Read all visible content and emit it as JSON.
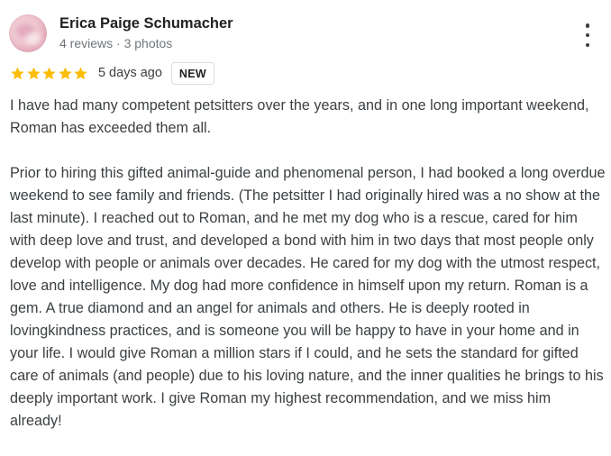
{
  "review": {
    "author_name": "Erica Paige Schumacher",
    "author_meta": "4 reviews · 3 photos",
    "rating": 5,
    "rating_max": 5,
    "date": "5 days ago",
    "badge": "NEW",
    "paragraphs": [
      "I have had many competent petsitters over the years, and in one long important weekend, Roman has exceeded them all.",
      "Prior to hiring this gifted animal-guide and phenomenal person, I had booked a long overdue weekend to see family and friends. (The petsitter I had originally hired was a no show at the last minute). I reached out to Roman, and he met my dog who is a rescue, cared for him with deep love and trust, and developed a bond with him in two days that most people only develop with people or animals over decades. He cared for my dog with the utmost respect, love and intelligence. My dog had more confidence in himself upon my return. Roman is a gem. A true diamond and an angel for animals and others. He is deeply rooted in lovingkindness practices, and is someone you will be happy to have in your home and in your life. I would give Roman a million stars if I could, and he sets the standard for gifted care of animals (and people) due to his loving nature, and the inner qualities he brings to his deeply important work. I give Roman my highest recommendation, and we miss him already!"
    ]
  },
  "icons": {
    "more": "more-vert-icon",
    "star": "star-icon"
  },
  "colors": {
    "star": "#fbbc04",
    "name": "#202124",
    "meta": "#70757a",
    "body": "#3c4043",
    "badge_border": "#dadce0"
  }
}
